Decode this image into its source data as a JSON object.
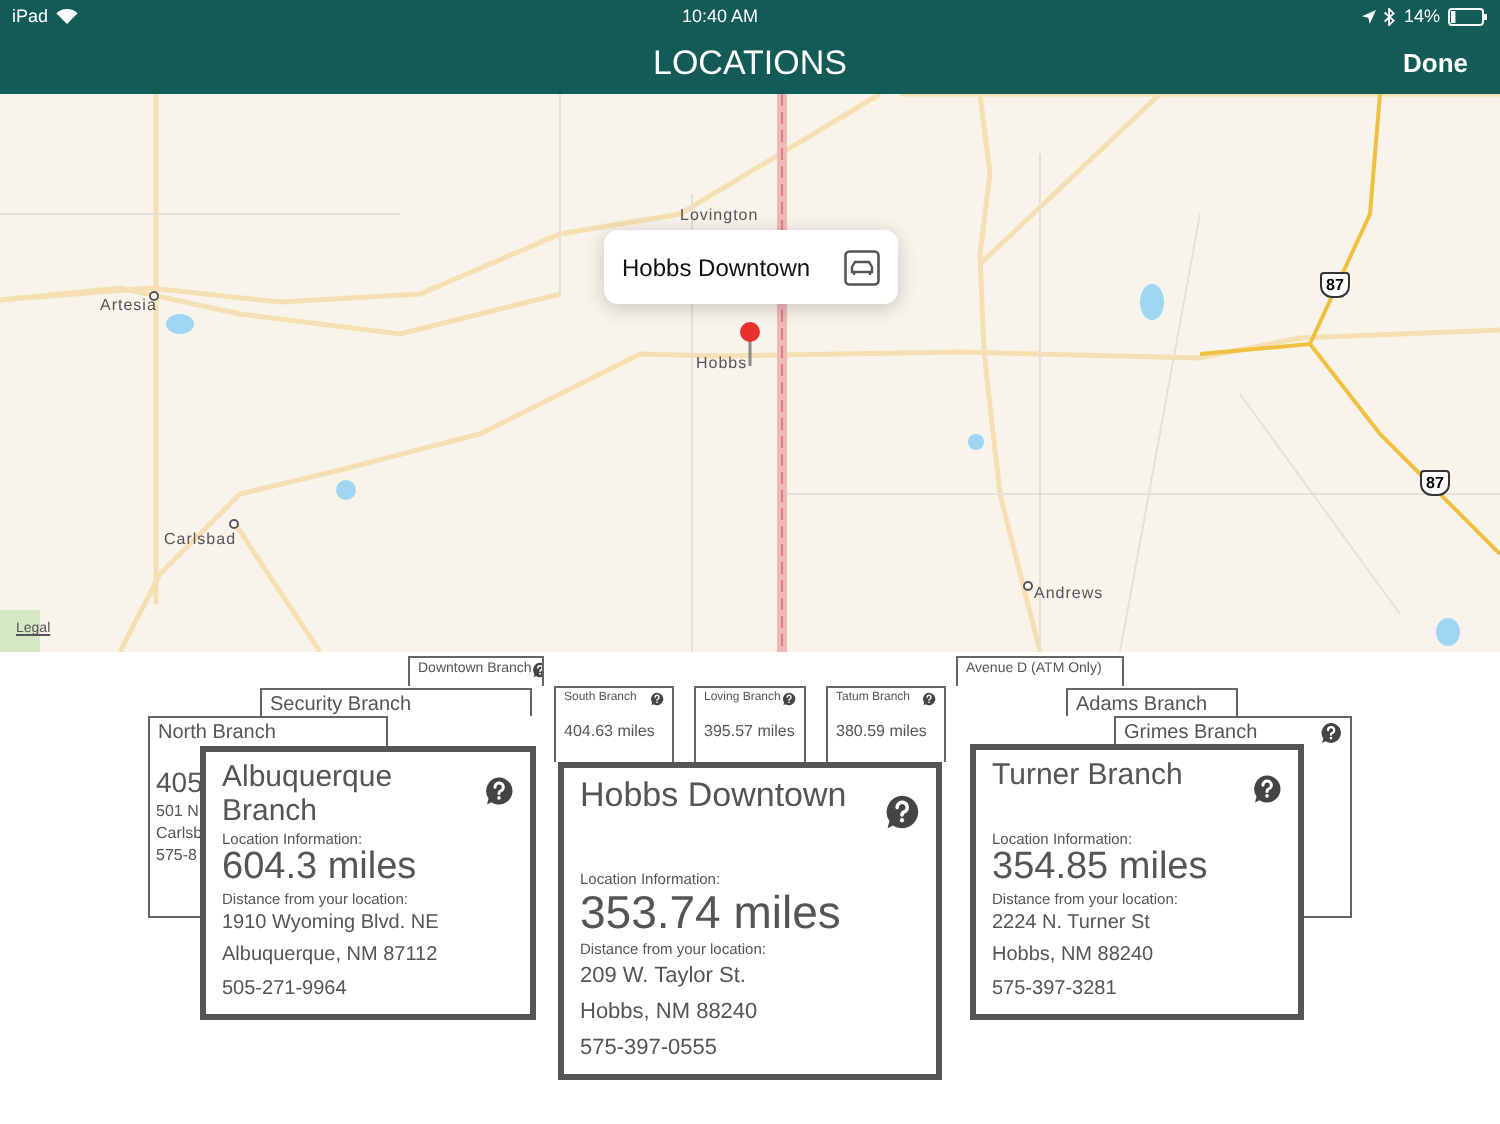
{
  "status_bar": {
    "device": "iPad",
    "time": "10:40 AM",
    "battery": "14%"
  },
  "nav": {
    "title": "LOCATIONS",
    "done": "Done"
  },
  "map": {
    "places": [
      "Lovington",
      "Artesia",
      "Hobbs",
      "Carlsbad",
      "Andrews"
    ],
    "shields": [
      "87",
      "87"
    ],
    "callout": "Hobbs Downtown",
    "legal": "Legal"
  },
  "back_cards": [
    {
      "title": "North Branch",
      "edge_lines": [
        "405",
        "501 N",
        "Carlsb",
        "575-8"
      ]
    },
    {
      "title": "Security Branch"
    },
    {
      "title": "Downtown Branch"
    },
    {
      "title": "South Branch",
      "lines": [
        "404.63 miles"
      ]
    },
    {
      "title": "Loving Branch",
      "lines": [
        "395.57 miles"
      ]
    },
    {
      "title": "Tatum Branch",
      "lines": [
        "380.59 miles"
      ]
    },
    {
      "title": "Avenue D (ATM Only)"
    },
    {
      "title": "Adams Branch"
    },
    {
      "title": "Grimes Branch"
    }
  ],
  "front_cards": [
    {
      "title": "Albuquerque Branch",
      "info_label": "Location Information:",
      "distance": "604.3 miles",
      "distance_label": "Distance from your location:",
      "lines": [
        "1910 Wyoming Blvd. NE",
        "Albuquerque, NM 87112",
        "505-271-9964"
      ]
    },
    {
      "title": "Hobbs Downtown",
      "info_label": "Location Information:",
      "distance": "353.74 miles",
      "distance_label": "Distance from your location:",
      "lines": [
        "209 W. Taylor St.",
        "Hobbs, NM 88240",
        "575-397-0555"
      ]
    },
    {
      "title": "Turner  Branch",
      "info_label": "Location Information:",
      "distance": "354.85 miles",
      "distance_label": "Distance from your location:",
      "lines": [
        "2224 N. Turner St",
        "Hobbs, NM 88240",
        "575-397-3281"
      ]
    }
  ]
}
